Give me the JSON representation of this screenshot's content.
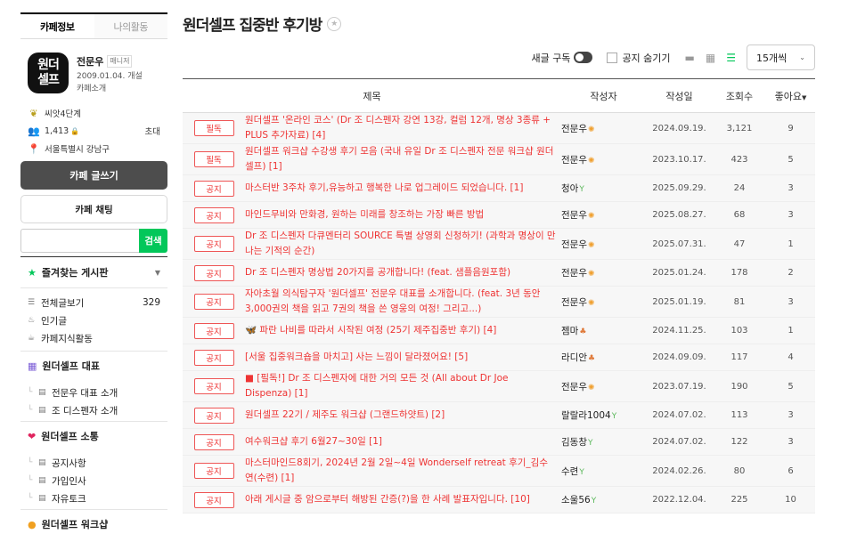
{
  "sidebar": {
    "tabs": [
      "카페정보",
      "나의활동"
    ],
    "logo_text": "원더\n셀프",
    "manager_name": "전문우",
    "manager_badge": "매니저",
    "since": "2009.01.04. 개설",
    "intro": "카페소개",
    "level": "씨앗4단계",
    "members": "1,413",
    "invite": "초대",
    "location": "서울특별시 강남구",
    "write_btn": "카페 글쓰기",
    "chat_btn": "카페 채팅",
    "search_btn": "검색",
    "fav_title": "즐겨찾는 게시판",
    "menu": [
      {
        "label": "전체글보기",
        "count": "329"
      },
      {
        "label": "인기글",
        "count": ""
      },
      {
        "label": "카페지식활동",
        "count": ""
      }
    ],
    "groups": [
      {
        "title": "원더셀프 대표",
        "items": [
          "전문우 대표 소개",
          "조 디스펜자 소개"
        ]
      },
      {
        "title": "원더셀프 소통",
        "items": [
          "공지사항",
          "가입인사",
          "자유토크"
        ]
      },
      {
        "title": "원더셀프 워크샵",
        "items": []
      }
    ]
  },
  "main": {
    "title": "원더셀프 집중반 후기방",
    "subscribe_label": "새글 구독",
    "hide_notice_label": "공지 숨기기",
    "page_size": "15개씩",
    "columns": [
      "제목",
      "작성자",
      "작성일",
      "조회수",
      "좋아요"
    ],
    "rows": [
      {
        "badge": "필독",
        "title": "원더셀프 '온라인 코스' (Dr 조 디스펜자 강연 13강, 컬럼 12개, 명상 3종류 + PLUS 추가자료) [4]",
        "author": "전문우",
        "lv": "✺",
        "lvc": "#f0a030",
        "date": "2024.09.19.",
        "views": "3,121",
        "likes": "9"
      },
      {
        "badge": "필독",
        "title": "원더셀프 워크샵 수강생 후기 모음 (국내 유일 Dr 조 디스펜자 전문 워크샵 원더셀프) [1]",
        "author": "전문우",
        "lv": "✺",
        "lvc": "#f0a030",
        "date": "2023.10.17.",
        "views": "423",
        "likes": "5"
      },
      {
        "badge": "공지",
        "title": "마스터반 3주차 후기,유능하고 행복한 나로 업그레이드 되었습니다. [1]",
        "author": "청아",
        "lv": "Y",
        "lvc": "#5cb85c",
        "date": "2025.09.29.",
        "views": "24",
        "likes": "3"
      },
      {
        "badge": "공지",
        "title": "마인드무비와 만화경, 원하는 미래를 창조하는 가장 빠른 방법",
        "author": "전문우",
        "lv": "✺",
        "lvc": "#f0a030",
        "date": "2025.08.27.",
        "views": "68",
        "likes": "3"
      },
      {
        "badge": "공지",
        "title": "Dr 조 디스펜자 다큐멘터리 SOURCE 특별 상영회 신청하기! (과학과 명상이 만나는 기적의 순간)",
        "author": "전문우",
        "lv": "✺",
        "lvc": "#f0a030",
        "date": "2025.07.31.",
        "views": "47",
        "likes": "1"
      },
      {
        "badge": "공지",
        "title": "Dr 조 디스펜자 명상법 20가지를 공개합니다! (feat. 샘플음원포함)",
        "author": "전문우",
        "lv": "✺",
        "lvc": "#f0a030",
        "date": "2025.01.24.",
        "views": "178",
        "likes": "2"
      },
      {
        "badge": "공지",
        "title": "자아초월 의식탐구자 '원더셀프' 전문우 대표를 소개합니다. (feat. 3년 동안 3,000권의 책을 읽고 7권의 책을 쓴 영웅의 여정! 그리고...)",
        "author": "전문우",
        "lv": "✺",
        "lvc": "#f0a030",
        "date": "2025.01.19.",
        "views": "81",
        "likes": "3"
      },
      {
        "badge": "공지",
        "title": "🦋 파란 나비를 따라서 시작된 여정 (25기 제주집중반 후기) [4]",
        "author": "젬마",
        "lv": "♣",
        "lvc": "#e07a3a",
        "date": "2024.11.25.",
        "views": "103",
        "likes": "1"
      },
      {
        "badge": "공지",
        "title": "[서울 집중워크숍을 마치고] 사는 느낌이 달라졌어요! [5]",
        "author": "라디안",
        "lv": "♣",
        "lvc": "#e07a3a",
        "date": "2024.09.09.",
        "views": "117",
        "likes": "4"
      },
      {
        "badge": "공지",
        "title": "■ [필독!] Dr 조 디스펜자에 대한 거의 모든 것 (All about Dr Joe Dispenza) [1]",
        "author": "전문우",
        "lv": "✺",
        "lvc": "#f0a030",
        "date": "2023.07.19.",
        "views": "190",
        "likes": "5"
      },
      {
        "badge": "공지",
        "title": "원더셀프 22기 / 제주도 워크샵 (그랜드하얏트) [2]",
        "author": "랄랄라1004",
        "lv": "Y",
        "lvc": "#5cb85c",
        "date": "2024.07.02.",
        "views": "113",
        "likes": "3"
      },
      {
        "badge": "공지",
        "title": "여수워크샵 후기 6월27~30일 [1]",
        "author": "김동창",
        "lv": "Y",
        "lvc": "#5cb85c",
        "date": "2024.07.02.",
        "views": "122",
        "likes": "3"
      },
      {
        "badge": "공지",
        "title": "마스터마인드8회기, 2024년 2월 2일~4일 Wonderself retreat 후기_김수연(수련) [1]",
        "author": "수련",
        "lv": "Y",
        "lvc": "#5cb85c",
        "date": "2024.02.26.",
        "views": "80",
        "likes": "6"
      },
      {
        "badge": "공지",
        "title": "아래 게시글 중 암으로부터 해방된 간증(?)을 한 사례 발표자입니다. [10]",
        "author": "소울56",
        "lv": "Y",
        "lvc": "#5cb85c",
        "date": "2022.12.04.",
        "views": "225",
        "likes": "10"
      }
    ]
  }
}
